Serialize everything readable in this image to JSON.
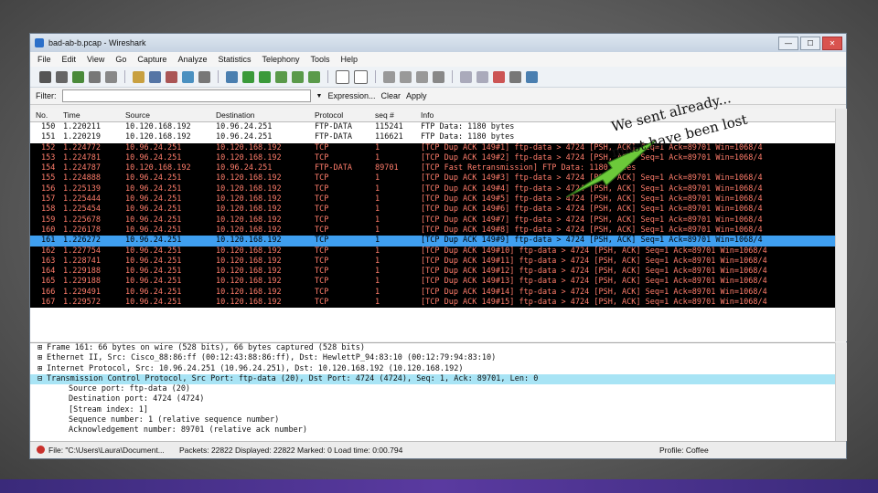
{
  "window": {
    "title": "bad-ab-b.pcap - Wireshark",
    "min": "—",
    "max": "☐",
    "close": "✕"
  },
  "menu": [
    "File",
    "Edit",
    "View",
    "Go",
    "Capture",
    "Analyze",
    "Statistics",
    "Telephony",
    "Tools",
    "Help"
  ],
  "filter": {
    "label": "Filter:",
    "value": "",
    "expression": "Expression...",
    "clear": "Clear",
    "apply": "Apply"
  },
  "columns": [
    "No.",
    "Time",
    "Source",
    "Destination",
    "Protocol",
    "seq #",
    "Info"
  ],
  "packets": [
    {
      "no": "150",
      "time": "1.220211",
      "src": "10.120.168.192",
      "dst": "10.96.24.251",
      "proto": "FTP-DATA",
      "seq": "115241",
      "info": "FTP Data: 1180 bytes",
      "style": "light"
    },
    {
      "no": "151",
      "time": "1.220219",
      "src": "10.120.168.192",
      "dst": "10.96.24.251",
      "proto": "FTP-DATA",
      "seq": "116621",
      "info": "FTP Data: 1180 bytes",
      "style": "light"
    },
    {
      "no": "152",
      "time": "1.224772",
      "src": "10.96.24.251",
      "dst": "10.120.168.192",
      "proto": "TCP",
      "seq": "1",
      "info": "[TCP Dup ACK 149#1] ftp-data > 4724 [PSH, ACK] Seq=1 Ack=89701 Win=1068/4",
      "style": "dark"
    },
    {
      "no": "153",
      "time": "1.224781",
      "src": "10.96.24.251",
      "dst": "10.120.168.192",
      "proto": "TCP",
      "seq": "1",
      "info": "[TCP Dup ACK 149#2] ftp-data > 4724 [PSH, ACK] Seq=1 Ack=89701 Win=1068/4",
      "style": "dark"
    },
    {
      "no": "154",
      "time": "1.224787",
      "src": "10.120.168.192",
      "dst": "10.96.24.251",
      "proto": "FTP-DATA",
      "seq": "89701",
      "info": "[TCP Fast Retransmission] FTP Data: 1180 bytes",
      "style": "dark"
    },
    {
      "no": "155",
      "time": "1.224888",
      "src": "10.96.24.251",
      "dst": "10.120.168.192",
      "proto": "TCP",
      "seq": "1",
      "info": "[TCP Dup ACK 149#3] ftp-data > 4724 [PSH, ACK] Seq=1 Ack=89701 Win=1068/4",
      "style": "dark"
    },
    {
      "no": "156",
      "time": "1.225139",
      "src": "10.96.24.251",
      "dst": "10.120.168.192",
      "proto": "TCP",
      "seq": "1",
      "info": "[TCP Dup ACK 149#4] ftp-data > 4724 [PSH, ACK] Seq=1 Ack=89701 Win=1068/4",
      "style": "dark"
    },
    {
      "no": "157",
      "time": "1.225444",
      "src": "10.96.24.251",
      "dst": "10.120.168.192",
      "proto": "TCP",
      "seq": "1",
      "info": "[TCP Dup ACK 149#5] ftp-data > 4724 [PSH, ACK] Seq=1 Ack=89701 Win=1068/4",
      "style": "dark"
    },
    {
      "no": "158",
      "time": "1.225454",
      "src": "10.96.24.251",
      "dst": "10.120.168.192",
      "proto": "TCP",
      "seq": "1",
      "info": "[TCP Dup ACK 149#6] ftp-data > 4724 [PSH, ACK] Seq=1 Ack=89701 Win=1068/4",
      "style": "dark"
    },
    {
      "no": "159",
      "time": "1.225678",
      "src": "10.96.24.251",
      "dst": "10.120.168.192",
      "proto": "TCP",
      "seq": "1",
      "info": "[TCP Dup ACK 149#7] ftp-data > 4724 [PSH, ACK] Seq=1 Ack=89701 Win=1068/4",
      "style": "dark"
    },
    {
      "no": "160",
      "time": "1.226178",
      "src": "10.96.24.251",
      "dst": "10.120.168.192",
      "proto": "TCP",
      "seq": "1",
      "info": "[TCP Dup ACK 149#8] ftp-data > 4724 [PSH, ACK] Seq=1 Ack=89701 Win=1068/4",
      "style": "dark"
    },
    {
      "no": "161",
      "time": "1.226272",
      "src": "10.96.24.251",
      "dst": "10.120.168.192",
      "proto": "TCP",
      "seq": "1",
      "info": "[TCP Dup ACK 149#9] ftp-data > 4724 [PSH, ACK] Seq=1 Ack=89701 Win=1068/4",
      "style": "selected"
    },
    {
      "no": "162",
      "time": "1.227754",
      "src": "10.96.24.251",
      "dst": "10.120.168.192",
      "proto": "TCP",
      "seq": "1",
      "info": "[TCP Dup ACK 149#10] ftp-data > 4724 [PSH, ACK] Seq=1 Ack=89701 Win=1068/4",
      "style": "dark"
    },
    {
      "no": "163",
      "time": "1.228741",
      "src": "10.96.24.251",
      "dst": "10.120.168.192",
      "proto": "TCP",
      "seq": "1",
      "info": "[TCP Dup ACK 149#11] ftp-data > 4724 [PSH, ACK] Seq=1 Ack=89701 Win=1068/4",
      "style": "dark"
    },
    {
      "no": "164",
      "time": "1.229188",
      "src": "10.96.24.251",
      "dst": "10.120.168.192",
      "proto": "TCP",
      "seq": "1",
      "info": "[TCP Dup ACK 149#12] ftp-data > 4724 [PSH, ACK] Seq=1 Ack=89701 Win=1068/4",
      "style": "dark"
    },
    {
      "no": "165",
      "time": "1.229188",
      "src": "10.96.24.251",
      "dst": "10.120.168.192",
      "proto": "TCP",
      "seq": "1",
      "info": "[TCP Dup ACK 149#13] ftp-data > 4724 [PSH, ACK] Seq=1 Ack=89701 Win=1068/4",
      "style": "dark"
    },
    {
      "no": "166",
      "time": "1.229491",
      "src": "10.96.24.251",
      "dst": "10.120.168.192",
      "proto": "TCP",
      "seq": "1",
      "info": "[TCP Dup ACK 149#14] ftp-data > 4724 [PSH, ACK] Seq=1 Ack=89701 Win=1068/4",
      "style": "dark"
    },
    {
      "no": "167",
      "time": "1.229572",
      "src": "10.96.24.251",
      "dst": "10.120.168.192",
      "proto": "TCP",
      "seq": "1",
      "info": "[TCP Dup ACK 149#15] ftp-data > 4724 [PSH, ACK] Seq=1 Ack=89701 Win=1068/4",
      "style": "dark"
    }
  ],
  "details": [
    {
      "text": "Frame 161: 66 bytes on wire (528 bits), 66 bytes captured (528 bits)",
      "exp": "⊞",
      "sel": false,
      "child": false
    },
    {
      "text": "Ethernet II, Src: Cisco_88:86:ff (00:12:43:88:86:ff), Dst: HewlettP_94:83:10 (00:12:79:94:83:10)",
      "exp": "⊞",
      "sel": false,
      "child": false
    },
    {
      "text": "Internet Protocol, Src: 10.96.24.251 (10.96.24.251), Dst: 10.120.168.192 (10.120.168.192)",
      "exp": "⊞",
      "sel": false,
      "child": false
    },
    {
      "text": "Transmission Control Protocol, Src Port: ftp-data (20), Dst Port: 4724 (4724), Seq: 1, Ack: 89701, Len: 0",
      "exp": "⊟",
      "sel": true,
      "child": false
    },
    {
      "text": "Source port: ftp-data (20)",
      "exp": "",
      "sel": false,
      "child": true
    },
    {
      "text": "Destination port: 4724 (4724)",
      "exp": "",
      "sel": false,
      "child": true
    },
    {
      "text": "[Stream index: 1]",
      "exp": "",
      "sel": false,
      "child": true
    },
    {
      "text": "Sequence number: 1      (relative sequence number)",
      "exp": "",
      "sel": false,
      "child": true
    },
    {
      "text": "Acknowledgement number: 89701      (relative ack number)",
      "exp": "",
      "sel": false,
      "child": true
    }
  ],
  "status": {
    "file": "File: \"C:\\Users\\Laura\\Document...",
    "packets": "Packets: 22822 Displayed: 22822 Marked: 0 Load time: 0:00.794",
    "profile": "Profile: Coffee"
  },
  "annotation": {
    "line1": "We sent already...",
    "line2": "must have been lost"
  },
  "colors": {
    "dark_bg": "#000000",
    "dark_fg": "#ff7d6b",
    "light_bg": "#ffffff",
    "selected_bg": "#3f9ff0",
    "arrow": "#6cc93a"
  }
}
